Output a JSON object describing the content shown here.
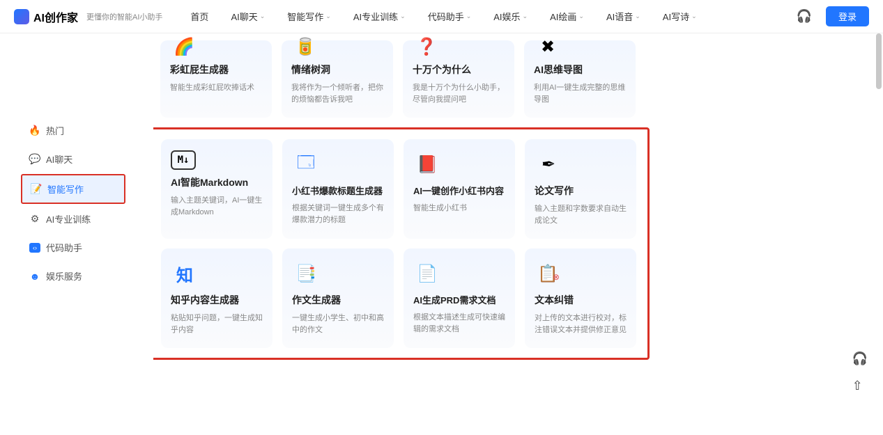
{
  "brand": "AI创作家",
  "tagline": "更懂你的智能AI小助手",
  "nav": [
    "首页",
    "AI聊天",
    "智能写作",
    "AI专业训练",
    "代码助手",
    "AI娱乐",
    "AI绘画",
    "AI语音",
    "AI写诗"
  ],
  "login": "登录",
  "sidebar": [
    {
      "label": "热门",
      "icon": "🔥"
    },
    {
      "label": "AI聊天",
      "icon": "💬"
    },
    {
      "label": "智能写作",
      "icon": "📝"
    },
    {
      "label": "AI专业训练",
      "icon": "⚙"
    },
    {
      "label": "代码助手",
      "icon": "‹›"
    },
    {
      "label": "娱乐服务",
      "icon": "☻"
    }
  ],
  "topCards": [
    {
      "title": "彩虹屁生成器",
      "desc": "智能生成彩虹屁吹捧话术",
      "icon": "🌈"
    },
    {
      "title": "情绪树洞",
      "desc": "我将作为一个倾听者，把你的烦恼都告诉我吧",
      "icon": "🥫"
    },
    {
      "title": "十万个为什么",
      "desc": "我是十万个为什么小助手，尽管向我提问吧",
      "icon": "❓"
    },
    {
      "title": "AI思维导图",
      "desc": "利用AI一键生成完整的思维导图",
      "icon": "✖"
    }
  ],
  "mainCards": [
    {
      "title": "AI智能Markdown",
      "desc": "输入主题关键词，AI一键生成Markdown",
      "icon": "M↓"
    },
    {
      "title": "小红书爆款标题生成器",
      "desc": "根据关键词一键生成多个有爆款潜力的标题",
      "icon": "🗔"
    },
    {
      "title": "AI一键创作小红书内容",
      "desc": "智能生成小红书",
      "icon": "📕"
    },
    {
      "title": "论文写作",
      "desc": "输入主题和字数要求自动生成论文",
      "icon": "✒"
    },
    {
      "title": "知乎内容生成器",
      "desc": "粘贴知乎问题，一键生成知乎内容",
      "icon": "知"
    },
    {
      "title": "作文生成器",
      "desc": "一键生成小学生、初中和高中的作文",
      "icon": "📑"
    },
    {
      "title": "AI生成PRD需求文档",
      "desc": "根据文本描述生成可快速编辑的需求文档",
      "icon": "📄"
    },
    {
      "title": "文本纠错",
      "desc": "对上传的文本进行校对，标注错误文本并提供修正意见",
      "icon": "📋"
    }
  ]
}
